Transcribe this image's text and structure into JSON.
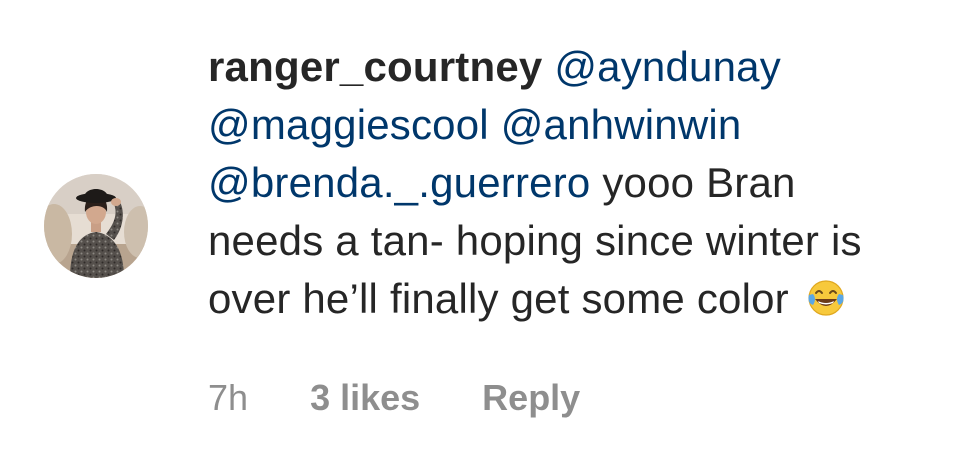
{
  "comment": {
    "username": "ranger_courtney",
    "mentions": [
      "@ayndunay",
      "@maggiescool",
      "@anhwinwin",
      "@brenda._.guerrero"
    ],
    "text_line3": "yooo Bran",
    "text_line4": "needs a tan- hoping since winter is",
    "text_line5": "over he’ll finally get some color",
    "emoji": "face-with-tears-of-joy",
    "avatar": "user-avatar-photo"
  },
  "meta": {
    "time": "7h",
    "likes": "3 likes",
    "reply": "Reply"
  },
  "colors": {
    "text": "#262626",
    "mention": "#00376b",
    "meta": "#8e8e8e",
    "background": "#ffffff"
  }
}
